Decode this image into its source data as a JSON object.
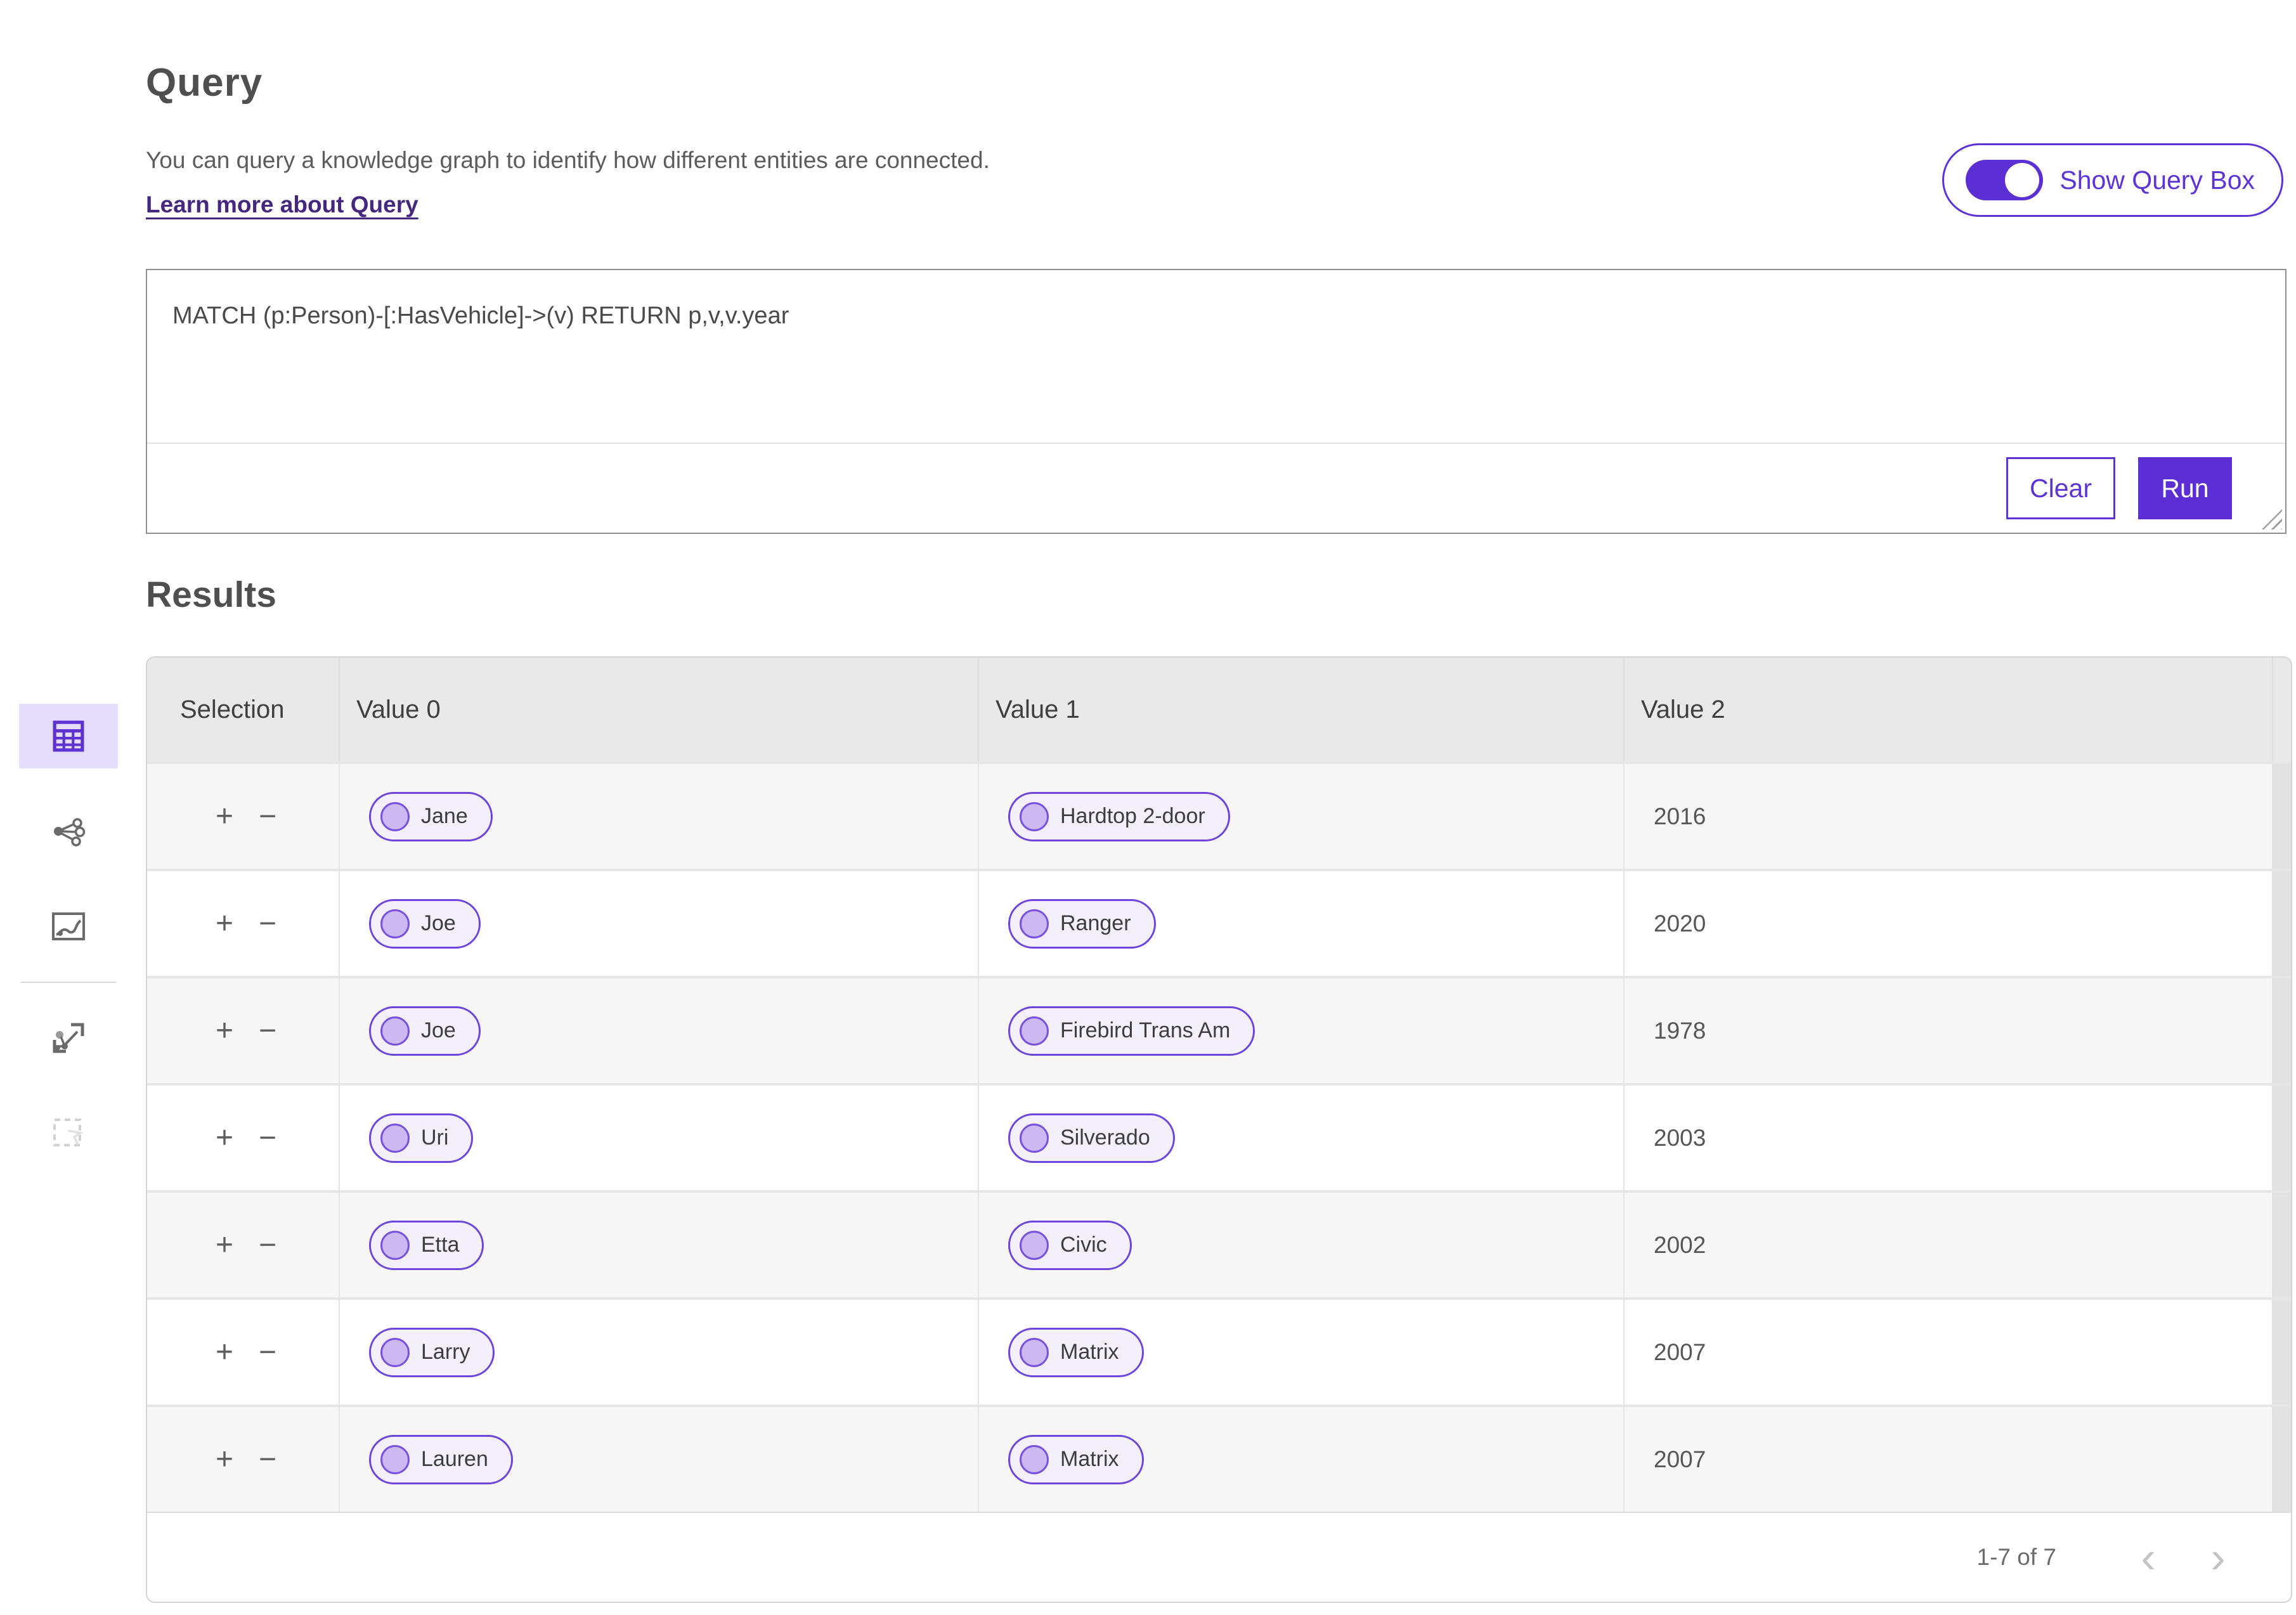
{
  "header": {
    "title": "Query",
    "description": "You can query a knowledge graph to identify how different entities are connected.",
    "learn_more_label": "Learn more about Query",
    "toggle": {
      "label": "Show Query Box",
      "state": "on"
    }
  },
  "query_box": {
    "query_text": "MATCH (p:Person)-[:HasVehicle]->(v) RETURN p,v,v.year",
    "clear_label": "Clear",
    "run_label": "Run"
  },
  "sidebar": {
    "items": [
      {
        "name": "table-view",
        "icon": "table-icon",
        "selected": true
      },
      {
        "name": "graph-view",
        "icon": "network-graph-icon",
        "selected": false
      },
      {
        "name": "map-view",
        "icon": "route-map-icon",
        "selected": false
      },
      {
        "name": "expand-graph-view",
        "icon": "expand-graph-icon",
        "selected": false
      },
      {
        "name": "select-region-view",
        "icon": "dashed-selection-icon",
        "selected": false,
        "disabled": true
      }
    ]
  },
  "results": {
    "title": "Results",
    "columns": {
      "selection": "Selection",
      "value0": "Value 0",
      "value1": "Value 1",
      "value2": "Value 2"
    },
    "row_controls": {
      "add_label": "+",
      "remove_label": "−"
    },
    "rows": [
      {
        "value0": "Jane",
        "value1": "Hardtop 2-door",
        "value2": "2016"
      },
      {
        "value0": "Joe",
        "value1": "Ranger",
        "value2": "2020"
      },
      {
        "value0": "Joe",
        "value1": "Firebird Trans Am",
        "value2": "1978"
      },
      {
        "value0": "Uri",
        "value1": "Silverado",
        "value2": "2003"
      },
      {
        "value0": "Etta",
        "value1": "Civic",
        "value2": "2002"
      },
      {
        "value0": "Larry",
        "value1": "Matrix",
        "value2": "2007"
      },
      {
        "value0": "Lauren",
        "value1": "Matrix",
        "value2": "2007"
      }
    ],
    "pagination": {
      "range_label": "1-7 of 7",
      "prev_icon": "‹",
      "next_icon": "›"
    }
  },
  "colors": {
    "accent": "#5c2fd4",
    "accent_outline": "#5d33d6",
    "link": "#46277f",
    "pill_border": "#6d44dd",
    "pill_bg": "#f3f0fc",
    "pill_circle": "#cbb9f1",
    "sidebar_selected_bg": "#e5defb",
    "table_header_bg": "#e9e9e9",
    "row_alt_bg": "#f6f6f6"
  }
}
